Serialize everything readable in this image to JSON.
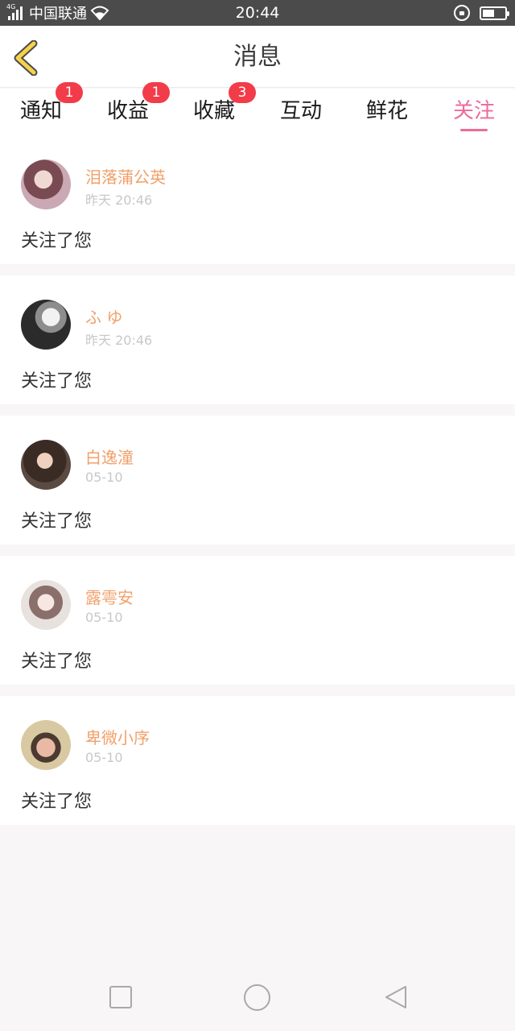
{
  "status_bar": {
    "network_type": "4G",
    "carrier": "中国联通",
    "time": "20:44",
    "battery_level": 0.55
  },
  "header": {
    "title": "消息",
    "back_icon": "chevron-left-icon",
    "accent_color": "#f6d24a"
  },
  "tabs": [
    {
      "label": "通知",
      "badge": "1"
    },
    {
      "label": "收益",
      "badge": "1"
    },
    {
      "label": "收藏",
      "badge": "3"
    },
    {
      "label": "互动",
      "badge": ""
    },
    {
      "label": "鲜花",
      "badge": ""
    },
    {
      "label": "关注",
      "badge": "",
      "active": true
    }
  ],
  "colors": {
    "active_tab": "#ee6a9b",
    "badge": "#f23c49",
    "name": "#f1a06a",
    "time": "#c8c8c8"
  },
  "follows": [
    {
      "name": "泪落蒲公英",
      "time": "昨天 20:46",
      "message": "关注了您"
    },
    {
      "name": "ふ ゆ",
      "time": "昨天 20:46",
      "message": "关注了您"
    },
    {
      "name": "白逸潼",
      "time": "05-10",
      "message": "关注了您"
    },
    {
      "name": "露雩安",
      "time": "05-10",
      "message": "关注了您"
    },
    {
      "name": "卑微小序",
      "time": "05-10",
      "message": "关注了您"
    }
  ],
  "nav_bar": {
    "icons": [
      "square-icon",
      "circle-icon",
      "triangle-back-icon"
    ]
  }
}
